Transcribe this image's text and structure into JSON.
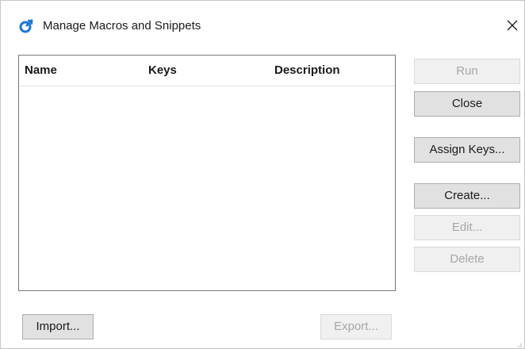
{
  "window": {
    "title": "Manage Macros and Snippets",
    "icon": "macro-app-icon",
    "close_icon": "close-icon"
  },
  "list": {
    "columns": [
      "Name",
      "Keys",
      "Description"
    ],
    "rows": []
  },
  "buttons": {
    "run": {
      "label": "Run",
      "enabled": false
    },
    "close": {
      "label": "Close",
      "enabled": true
    },
    "assign_keys": {
      "label": "Assign Keys...",
      "enabled": true
    },
    "create": {
      "label": "Create...",
      "enabled": true
    },
    "edit": {
      "label": "Edit...",
      "enabled": false
    },
    "delete": {
      "label": "Delete",
      "enabled": false
    },
    "import": {
      "label": "Import...",
      "enabled": true
    },
    "export": {
      "label": "Export...",
      "enabled": false
    }
  },
  "colors": {
    "accent": "#1f78d1",
    "button_bg": "#e1e1e1",
    "button_border": "#adadad",
    "disabled_text": "#a6a6a6"
  }
}
